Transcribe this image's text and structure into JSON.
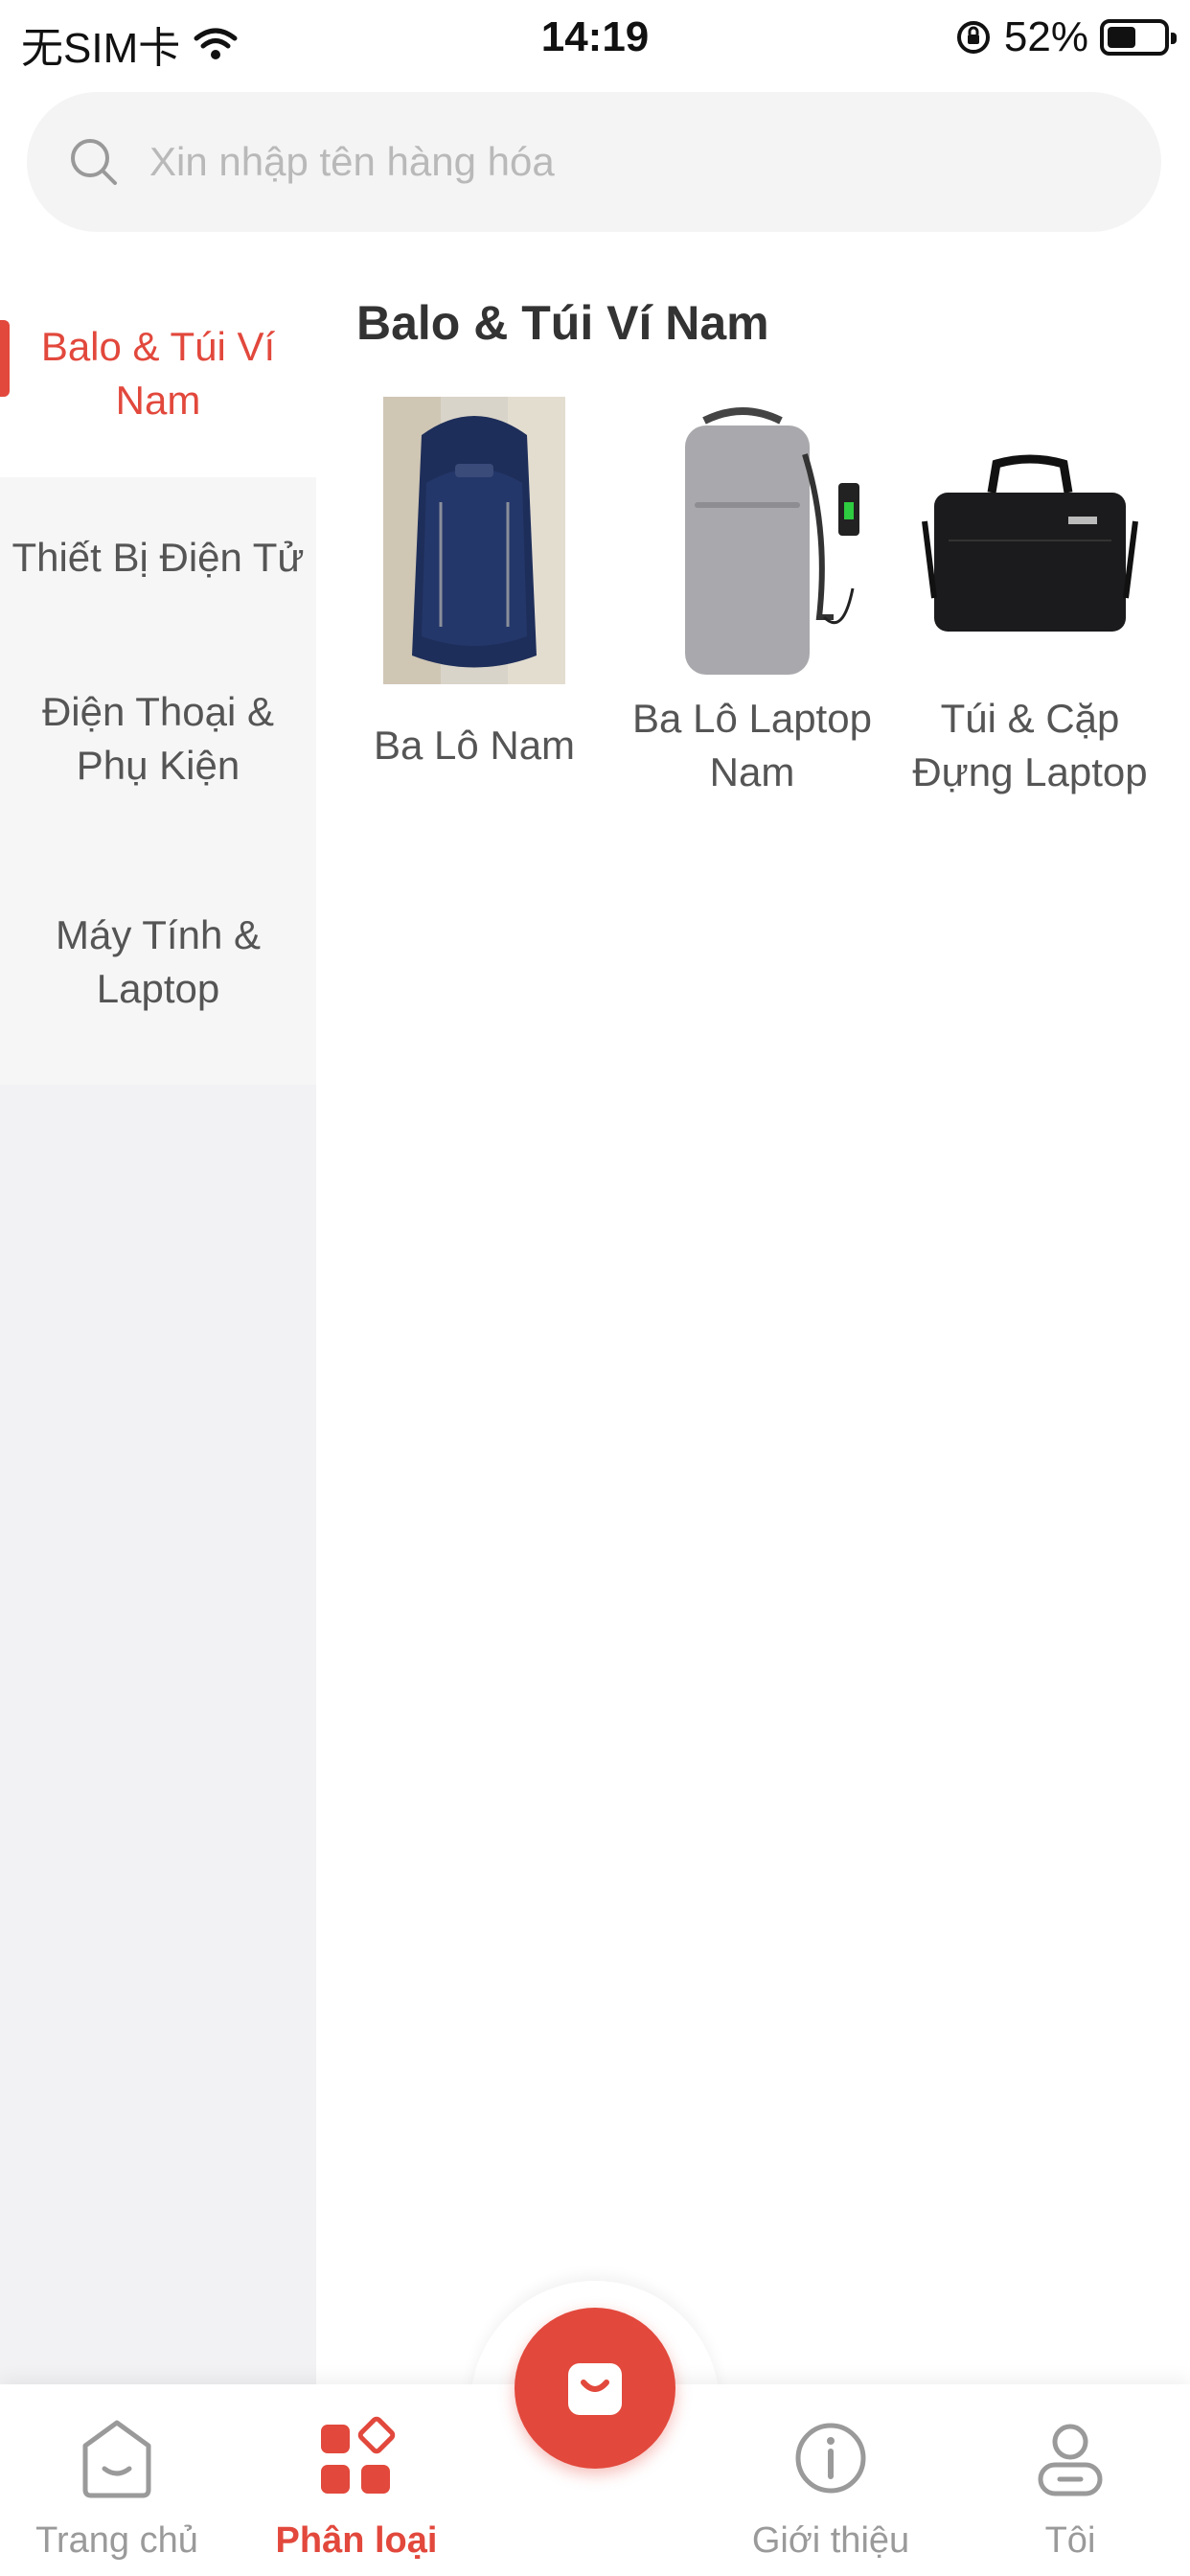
{
  "status_bar": {
    "carrier": "无SIM卡",
    "time": "14:19",
    "battery_percent": "52%",
    "battery_level": 0.52,
    "icons": [
      "wifi-icon",
      "orientation-lock-icon",
      "battery-icon"
    ]
  },
  "search": {
    "placeholder": "Xin nhập tên hàng hóa",
    "value": "",
    "icon": "search-icon"
  },
  "sidebar": {
    "items": [
      {
        "label": "Balo & Túi Ví Nam",
        "active": true
      },
      {
        "label": "Thiết Bị Điện Tử",
        "active": false
      },
      {
        "label": "Điện Thoại & Phụ Kiện",
        "active": false
      },
      {
        "label": "Máy Tính & Laptop",
        "active": false
      }
    ]
  },
  "content": {
    "title": "Balo & Túi Ví Nam",
    "products": [
      {
        "label": "Ba Lô Nam",
        "image": "navy-backpack-photo"
      },
      {
        "label": "Ba Lô Laptop Nam",
        "image": "grey-laptop-backpack-photo"
      },
      {
        "label": "Túi & Cặp Đựng Laptop",
        "image": "black-laptop-bag-photo"
      }
    ]
  },
  "tabbar": {
    "tabs": [
      {
        "label": "Trang chủ",
        "icon": "home-icon",
        "active": false
      },
      {
        "label": "Phân loại",
        "icon": "category-icon",
        "active": true
      },
      {
        "label": "Giới thiệu",
        "icon": "info-icon",
        "active": false
      },
      {
        "label": "Tôi",
        "icon": "user-icon",
        "active": false
      }
    ],
    "center_button_icon": "shopping-bag-icon"
  },
  "colors": {
    "accent": "#e2483c",
    "sidebar_bg": "#f6f6f6",
    "search_bg": "#f4f4f4",
    "inactive_text": "#9a9a9a"
  }
}
